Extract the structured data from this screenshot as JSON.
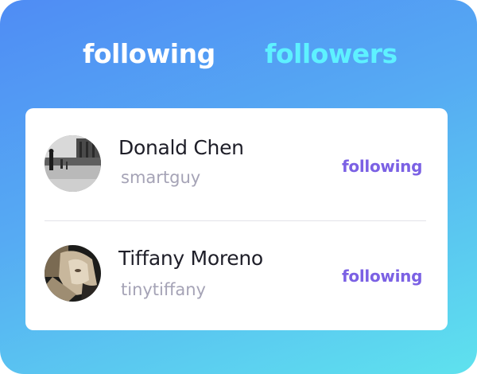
{
  "tabs": {
    "following": "following",
    "followers": "followers"
  },
  "users": [
    {
      "name": "Donald Chen",
      "username": "smartguy",
      "action": "following",
      "avatar_icon": "street-scene-photo-icon"
    },
    {
      "name": "Tiffany Moreno",
      "username": "tinytiffany",
      "action": "following",
      "avatar_icon": "portrait-photo-icon"
    }
  ],
  "colors": {
    "gradient_start": "#4f8cf4",
    "gradient_end": "#5ee2ee",
    "active_tab": "#ffffff",
    "inactive_tab": "#5ef1ff",
    "action_text": "#7b61e4",
    "name_text": "#1e1e28",
    "username_text": "#a5a3b6"
  }
}
